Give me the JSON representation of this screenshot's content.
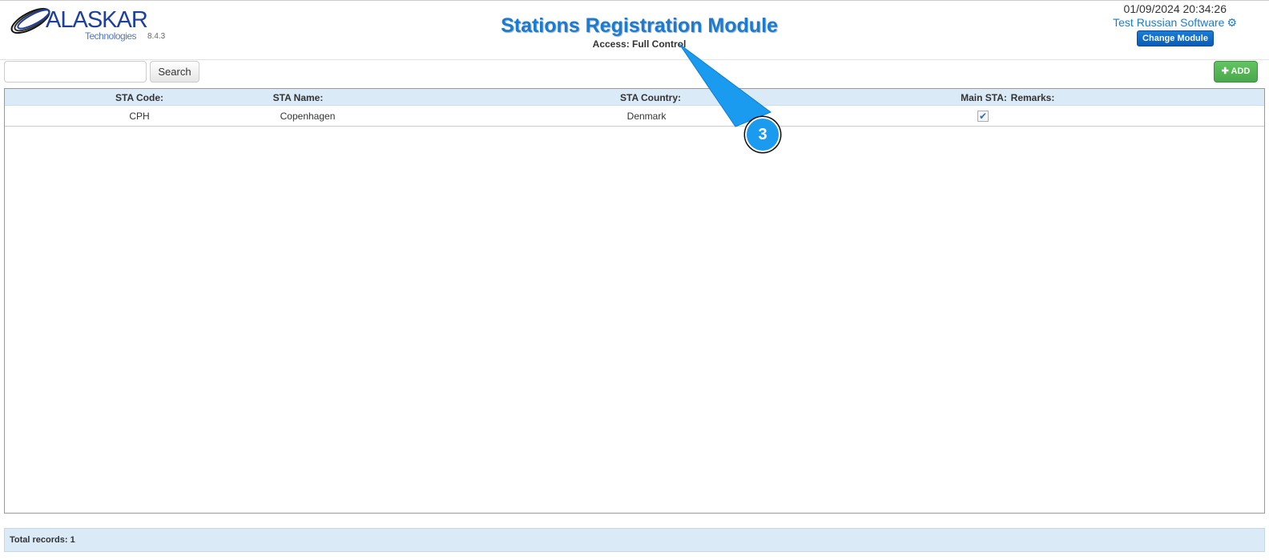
{
  "header": {
    "logo_text": "ALASKAR",
    "logo_sub": "Technologies",
    "version": "8.4.3",
    "title": "Stations Registration Module",
    "access": "Access: Full Control",
    "datetime": "01/09/2024 20:34:26",
    "user": "Test Russian Software",
    "change_module": "Change Module"
  },
  "toolbar": {
    "search_value": "",
    "search_label": "Search",
    "add_label": "ADD"
  },
  "table": {
    "columns": [
      "STA Code:",
      "STA Name:",
      "STA Country:",
      "Main STA:",
      "Remarks:"
    ],
    "rows": [
      {
        "code": "CPH",
        "name": "Copenhagen",
        "country": "Denmark",
        "main": true,
        "remarks": ""
      }
    ]
  },
  "footer": {
    "total": "Total records: 1"
  },
  "annotation": {
    "label": "3",
    "color": "#1a9bf0"
  }
}
